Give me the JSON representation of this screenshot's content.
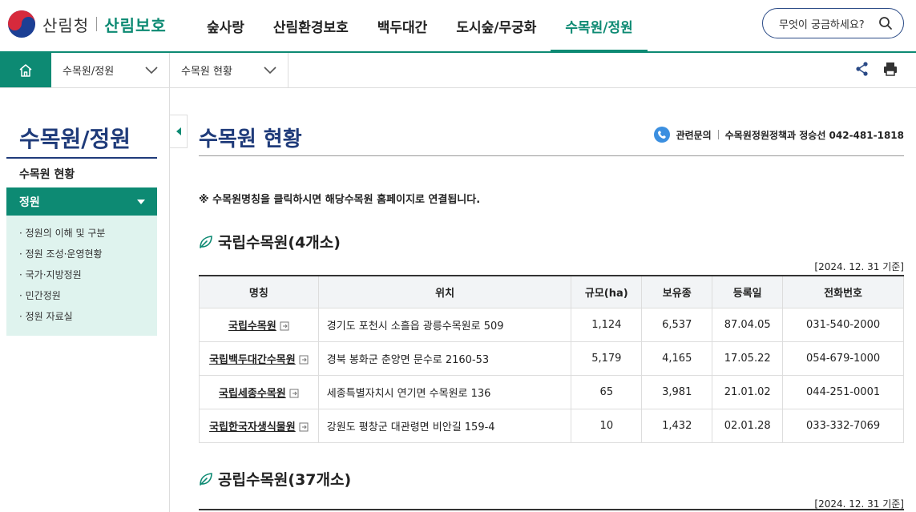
{
  "header": {
    "org_name": "산림청",
    "org_sub": "산림보호",
    "menu": [
      "숲사랑",
      "산림환경보호",
      "백두대간",
      "도시숲/무궁화",
      "수목원/정원"
    ],
    "active_menu_index": 4,
    "search_placeholder": "무엇이 궁금하세요?"
  },
  "breadcrumb": {
    "level1": "수목원/정원",
    "level2": "수목원 현황"
  },
  "sidebar": {
    "title": "수목원/정원",
    "item1": "수목원 현황",
    "active_group": "정원",
    "sub_items": [
      "정원의 이해 및 구분",
      "정원 조성·운영현황",
      "국가·지방정원",
      "민간정원",
      "정원 자료실"
    ]
  },
  "main": {
    "title": "수목원 현황",
    "contact_label": "관련문의",
    "contact_value": "수목원정원정책과 정승선 042-481-1818",
    "notice": "※ 수목원명칭을 클릭하시면 해당수목원 홈페이지로 연결됩니다.",
    "section1_title": "국립수목원(4개소)",
    "section1_basis": "[2024. 12. 31 기준]",
    "section2_title": "공립수목원(37개소)",
    "section2_basis": "[2024. 12. 31 기준]",
    "table": {
      "headers": [
        "명칭",
        "위치",
        "규모(ha)",
        "보유종",
        "등록일",
        "전화번호"
      ],
      "rows": [
        [
          "국립수목원",
          "경기도 포천시 소흘읍 광릉수목원로 509",
          "1,124",
          "6,537",
          "87.04.05",
          "031-540-2000"
        ],
        [
          "국립백두대간수목원",
          "경북 봉화군 춘양면 문수로 2160-53",
          "5,179",
          "4,165",
          "17.05.22",
          "054-679-1000"
        ],
        [
          "국립세종수목원",
          "세종특별자치시 연기면 수목원로 136",
          "65",
          "3,981",
          "21.01.02",
          "044-251-0001"
        ],
        [
          "국립한국자생식물원",
          "강원도 평창군 대관령면 비안길 159-4",
          "10",
          "1,432",
          "02.01.28",
          "033-332-7069"
        ]
      ]
    }
  },
  "colors": {
    "accent": "#0d8a73",
    "navy": "#1f3b7a",
    "sub_bg": "#dff3ee"
  }
}
